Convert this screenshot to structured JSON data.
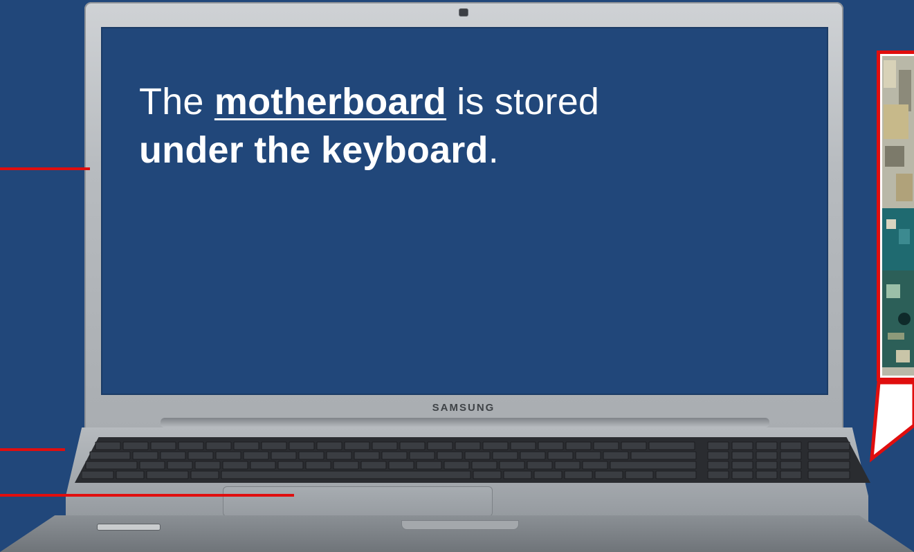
{
  "screen_text": {
    "prefix": "The ",
    "emphasis": "motherboard",
    "middle": " is stored",
    "location": "under the keyboard",
    "suffix": "."
  },
  "laptop_brand": "SAMSUNG",
  "colors": {
    "background": "#21477a",
    "callout_red": "#e00e0e",
    "text": "#ffffff"
  },
  "icons": [
    "laptop-image",
    "motherboard-photo",
    "callout-pointer"
  ]
}
